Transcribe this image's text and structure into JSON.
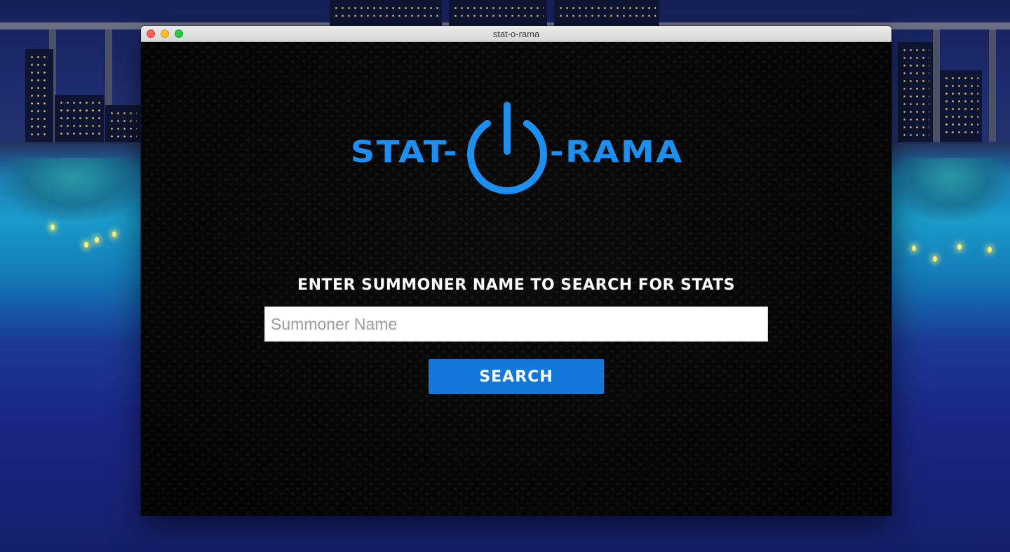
{
  "window": {
    "title": "stat-o-rama"
  },
  "logo": {
    "left_text": "STAT-",
    "right_text": "-RAMA",
    "icon": "power-icon",
    "color": "#1c8ff0"
  },
  "search": {
    "prompt": "ENTER SUMMONER NAME TO SEARCH FOR STATS",
    "placeholder": "Summoner Name",
    "value": "",
    "button_label": "SEARCH",
    "button_color": "#1478da"
  }
}
